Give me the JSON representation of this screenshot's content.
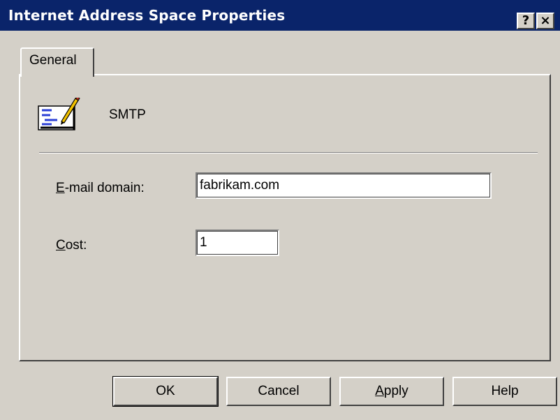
{
  "window": {
    "title": "Internet Address Space Properties",
    "help_button": "?",
    "close_button": "×"
  },
  "tabs": [
    {
      "label": "General",
      "active": true
    }
  ],
  "general": {
    "icon": "smtp-connector-icon",
    "address_type": "SMTP",
    "email_domain": {
      "label_accel": "E",
      "label_rest": "-mail domain:",
      "value": "fabrikam.com"
    },
    "cost": {
      "label_accel": "C",
      "label_rest": "ost:",
      "value": "1"
    }
  },
  "buttons": {
    "ok": "OK",
    "cancel": "Cancel",
    "apply_accel": "A",
    "apply_rest": "pply",
    "help": "Help"
  },
  "colors": {
    "title_bar": "#0a246a",
    "face": "#d4d0c8"
  }
}
